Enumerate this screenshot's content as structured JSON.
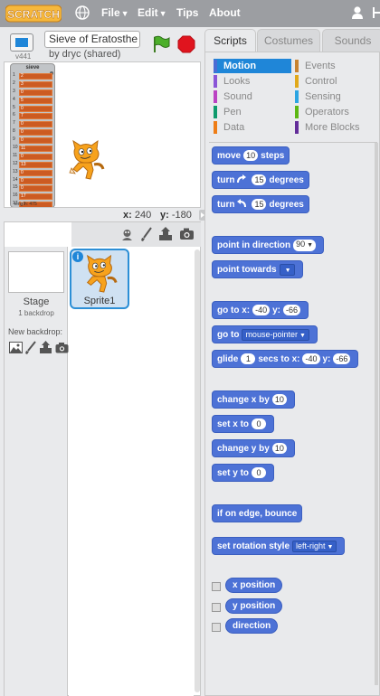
{
  "topbar": {
    "logo_text": "SCRATCH",
    "menus": [
      {
        "label": "File",
        "has_caret": true
      },
      {
        "label": "Edit",
        "has_caret": true
      },
      {
        "label": "Tips",
        "has_caret": false
      },
      {
        "label": "About",
        "has_caret": false
      }
    ],
    "colors": {
      "bar": "#9c9ea2",
      "logo": "#f5a623"
    }
  },
  "stage_header": {
    "version": "v441",
    "project_title": "Sieve of Eratosthe",
    "byline": "by dryc (shared)"
  },
  "list_monitor": {
    "title": "sieve",
    "indices": [
      "1",
      "2",
      "3",
      "4",
      "5",
      "6",
      "7",
      "8",
      "9",
      "10",
      "11",
      "12",
      "13",
      "14",
      "15",
      "16",
      "17"
    ],
    "values": [
      "2",
      "3",
      "0",
      "5",
      "0",
      "7",
      "0",
      "0",
      "0",
      "11",
      "0",
      "13",
      "0",
      "0",
      "0",
      "17",
      "0"
    ],
    "footer": "length: 475"
  },
  "coords": {
    "x_label": "x:",
    "x_value": "240",
    "y_label": "y:",
    "y_value": "-180"
  },
  "sprite_pane": {
    "stage_label": "Stage",
    "backdrop_count": "1 backdrop",
    "new_backdrop": "New backdrop:",
    "sprite_name": "Sprite1",
    "info_glyph": "i"
  },
  "tabs": [
    "Scripts",
    "Costumes",
    "Sounds"
  ],
  "categories": [
    {
      "label": "Motion",
      "color": "#4a6cd4",
      "selected": true
    },
    {
      "label": "Looks",
      "color": "#8a55d7"
    },
    {
      "label": "Sound",
      "color": "#bb42c3"
    },
    {
      "label": "Pen",
      "color": "#0e9a6c"
    },
    {
      "label": "Data",
      "color": "#ee7d16"
    },
    {
      "label": "Events",
      "color": "#c88330"
    },
    {
      "label": "Control",
      "color": "#e1a91a"
    },
    {
      "label": "Sensing",
      "color": "#2ca5e2"
    },
    {
      "label": "Operators",
      "color": "#5cb712"
    },
    {
      "label": "More Blocks",
      "color": "#632d99"
    }
  ],
  "blocks": {
    "move": {
      "pre": "move",
      "val": "10",
      "post": "steps"
    },
    "turn_right": {
      "pre": "turn",
      "val": "15",
      "post": "degrees"
    },
    "turn_left": {
      "pre": "turn",
      "val": "15",
      "post": "degrees"
    },
    "point_dir": {
      "pre": "point in direction",
      "val": "90"
    },
    "point_towards": {
      "pre": "point towards"
    },
    "goto_xy": {
      "pre": "go to x:",
      "x": "-40",
      "mid": "y:",
      "y": "-66"
    },
    "goto": {
      "pre": "go to",
      "val": "mouse-pointer"
    },
    "glide": {
      "pre": "glide",
      "val": "1",
      "mid1": "secs to x:",
      "x": "-40",
      "mid2": "y:",
      "y": "-66"
    },
    "change_x": {
      "pre": "change x by",
      "val": "10"
    },
    "set_x": {
      "pre": "set x to",
      "val": "0"
    },
    "change_y": {
      "pre": "change y by",
      "val": "10"
    },
    "set_y": {
      "pre": "set y to",
      "val": "0"
    },
    "bounce": {
      "label": "if on edge, bounce"
    },
    "rotation": {
      "pre": "set rotation style",
      "val": "left-right"
    },
    "x_position": {
      "label": "x position"
    },
    "y_position": {
      "label": "y position"
    },
    "direction": {
      "label": "direction"
    }
  }
}
